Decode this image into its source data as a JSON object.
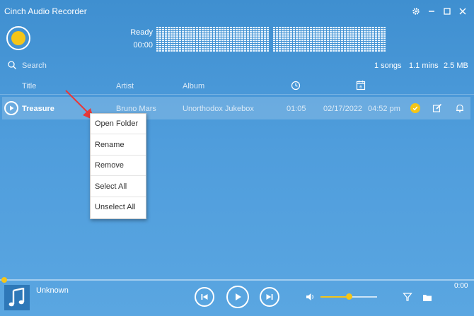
{
  "window": {
    "title": "Cinch Audio Recorder"
  },
  "recorder": {
    "status": "Ready",
    "time": "00:00"
  },
  "search": {
    "label": "Search"
  },
  "stats": {
    "songs": "1 songs",
    "duration": "1.1 mins",
    "size": "2.5 MB"
  },
  "columns": {
    "title": "Title",
    "artist": "Artist",
    "album": "Album",
    "duration_icon": "clock-icon",
    "date_icon": "calendar-icon"
  },
  "calendar_day": "6",
  "track": {
    "title": "Treasure",
    "artist": "Bruno Mars",
    "album": "Unorthodox Jukebox",
    "duration": "01:05",
    "date": "02/17/2022",
    "time": "04:52 pm"
  },
  "context_menu": {
    "items": [
      "Open Folder",
      "Rename",
      "Remove",
      "Select All",
      "Unselect All"
    ]
  },
  "player": {
    "now_playing": "Unknown",
    "elapsed": "0:00",
    "volume": 0.5
  },
  "colors": {
    "accent": "#f5c518",
    "background": "#4a97d8",
    "arrow": "#e8393a"
  }
}
